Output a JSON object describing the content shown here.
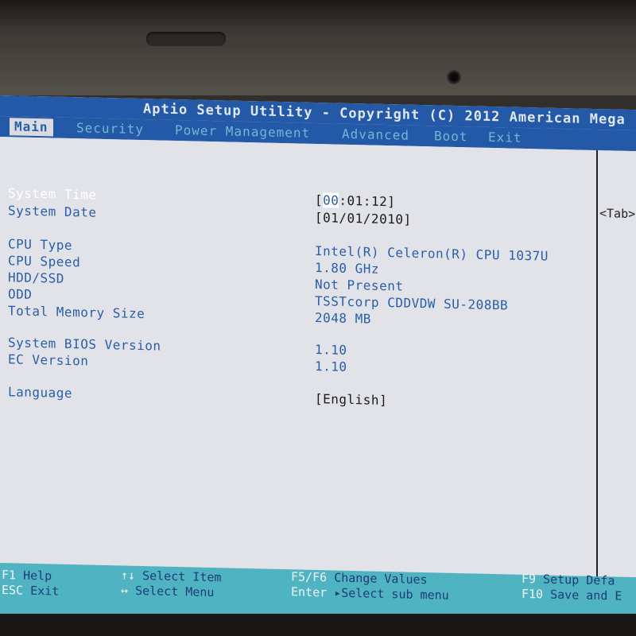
{
  "title": "Aptio Setup Utility - Copyright (C) 2012 American Mega",
  "tabs": [
    {
      "label": "Main",
      "active": true
    },
    {
      "label": "Security",
      "active": false
    },
    {
      "label": "Power Management",
      "active": false
    },
    {
      "label": "Advanced",
      "active": false
    },
    {
      "label": "Boot",
      "active": false
    },
    {
      "label": "Exit",
      "active": false
    }
  ],
  "settings": {
    "system_time": {
      "label": "System Time",
      "value_cursor": "00",
      "value_rest": ":01:12]",
      "value_open": "["
    },
    "system_date": {
      "label": "System Date",
      "value": "[01/01/2010]"
    },
    "cpu_type": {
      "label": "CPU Type",
      "value": "Intel(R) Celeron(R) CPU 1037U"
    },
    "cpu_speed": {
      "label": "CPU Speed",
      "value": "1.80 GHz"
    },
    "hdd_ssd": {
      "label": "HDD/SSD",
      "value": "Not Present"
    },
    "odd": {
      "label": "ODD",
      "value": "TSSTcorp CDDVDW SU-208BB"
    },
    "total_memory": {
      "label": "Total Memory Size",
      "value": "2048 MB"
    },
    "bios_version": {
      "label": "System BIOS Version",
      "value": "1.10"
    },
    "ec_version": {
      "label": "EC Version",
      "value": "1.10"
    },
    "language": {
      "label": "Language",
      "value": "[English]"
    }
  },
  "help_panel": {
    "text": "<Tab>"
  },
  "footer": {
    "f1": {
      "key": "F1",
      "desc": "Help"
    },
    "esc": {
      "key": "ESC",
      "desc": "Exit"
    },
    "select_item": {
      "key": "↑↓",
      "desc": "Select Item"
    },
    "select_menu": {
      "key": "↔",
      "desc": "Select Menu"
    },
    "change_values": {
      "key": "F5/F6",
      "desc": "Change Values"
    },
    "enter": {
      "key": "Enter",
      "desc": "▸Select sub menu"
    },
    "f9": {
      "key": "F9",
      "desc": "Setup Defa"
    },
    "f10": {
      "key": "F10",
      "desc": "Save and E"
    }
  },
  "colors": {
    "header_blue": "#2459a8",
    "panel_bg": "#e1e3e8",
    "text_blue": "#2a5ea8",
    "footer_cyan": "#4fb3c2"
  }
}
